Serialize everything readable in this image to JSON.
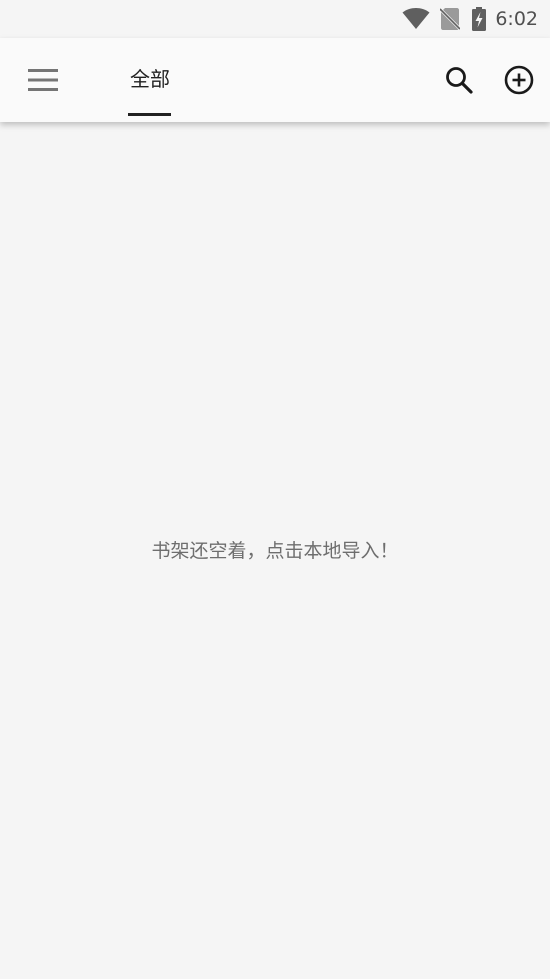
{
  "status_bar": {
    "time": "6:02",
    "icons": [
      "wifi-icon",
      "no-sim-icon",
      "battery-charging-icon"
    ]
  },
  "toolbar": {
    "menu_icon": "hamburger-menu-icon",
    "tabs": [
      {
        "label": "全部",
        "selected": true
      }
    ],
    "search_icon": "search-icon",
    "add_icon": "add-circle-icon"
  },
  "main": {
    "empty_message": "书架还空着，点击本地导入！"
  },
  "colors": {
    "background": "#f5f5f5",
    "toolbar": "#fafafa",
    "text_primary": "#212121",
    "text_secondary": "#6e6e6e",
    "icon_gray": "#757575"
  }
}
